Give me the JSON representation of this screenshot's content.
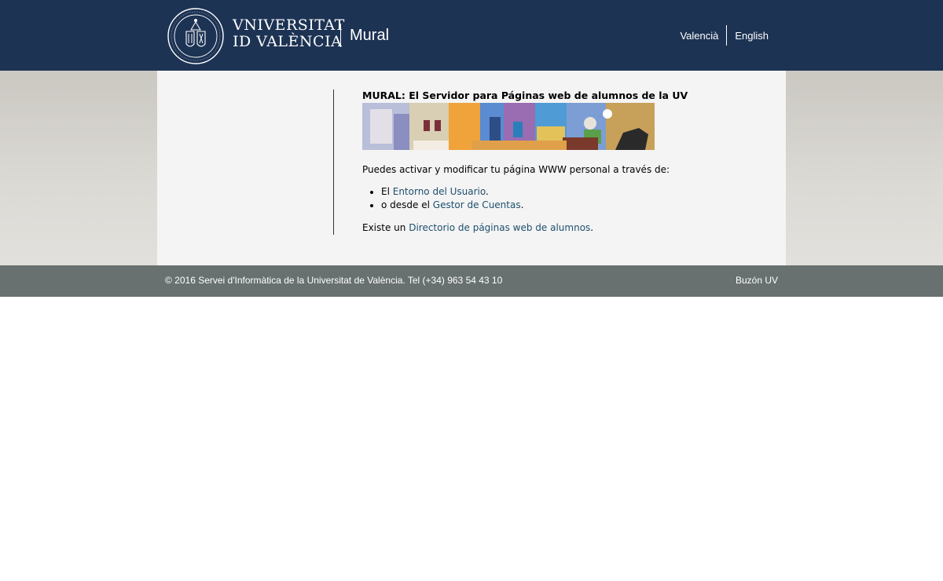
{
  "header": {
    "logo_alt": "university-seal",
    "wordmark_line1": "VNIVERSITAT",
    "wordmark_line2": "ID VALÈNCIA",
    "site_title": "Mural",
    "languages": [
      "Valencià",
      "English"
    ]
  },
  "main": {
    "title": "MURAL: El Servidor para Páginas web de alumnos de la UV",
    "banner_icon": "mural-banner-image",
    "intro": "Puedes activar y modificar tu página WWW personal a través de:",
    "list": [
      {
        "prefix": "El ",
        "link": "Entorno del Usuario",
        "suffix": "."
      },
      {
        "prefix": "o desde el ",
        "link": "Gestor de Cuentas",
        "suffix": "."
      }
    ],
    "directory": {
      "prefix": "Existe un ",
      "link": "Directorio de páginas web de alumnos",
      "suffix": "."
    }
  },
  "footer": {
    "copyright": "© 2016 Servei d'Informàtica de la Universitat de València. Tel (+34) 963 54 43 10",
    "mailbox": "Buzón UV"
  },
  "colors": {
    "header_bg": "#1d3354",
    "footer_bg": "#687170",
    "link": "#1d4f6e",
    "content_bg": "#f4f4f4"
  }
}
